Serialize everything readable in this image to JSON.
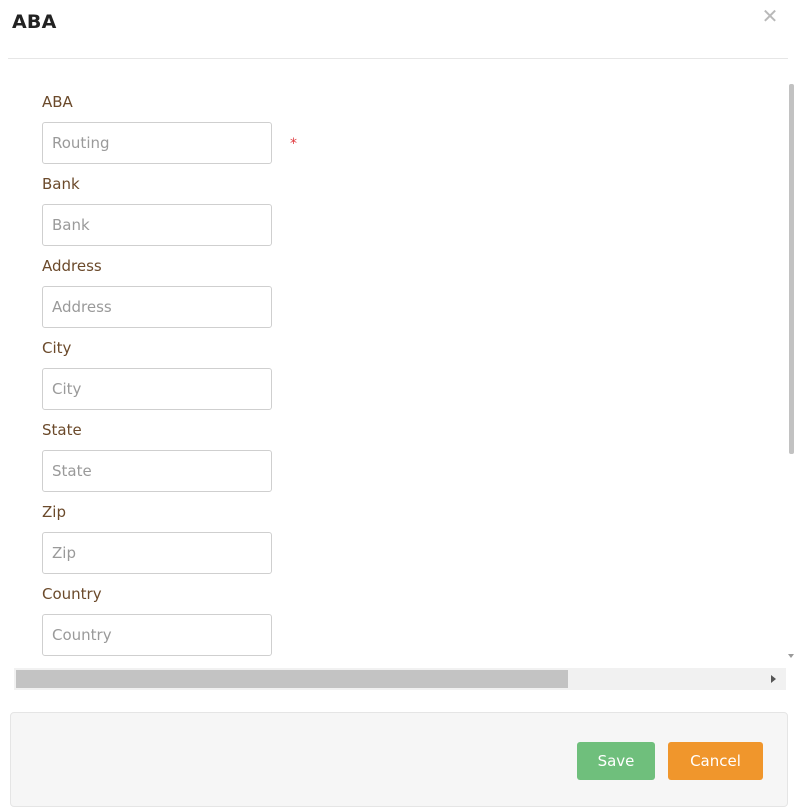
{
  "dialog": {
    "title": "ABA",
    "close_icon": "close-icon"
  },
  "form": {
    "fields": [
      {
        "label": "ABA",
        "placeholder": "Routing",
        "value": "",
        "required": true
      },
      {
        "label": "Bank",
        "placeholder": "Bank",
        "value": ""
      },
      {
        "label": "Address",
        "placeholder": "Address",
        "value": ""
      },
      {
        "label": "City",
        "placeholder": "City",
        "value": ""
      },
      {
        "label": "State",
        "placeholder": "State",
        "value": ""
      },
      {
        "label": "Zip",
        "placeholder": "Zip",
        "value": ""
      },
      {
        "label": "Country",
        "placeholder": "Country",
        "value": ""
      }
    ],
    "required_marker": "*"
  },
  "footer": {
    "save_label": "Save",
    "cancel_label": "Cancel"
  },
  "colors": {
    "label": "#6b4a2b",
    "required": "#e0393e",
    "save": "#6fbf7c",
    "cancel": "#f0962c"
  }
}
